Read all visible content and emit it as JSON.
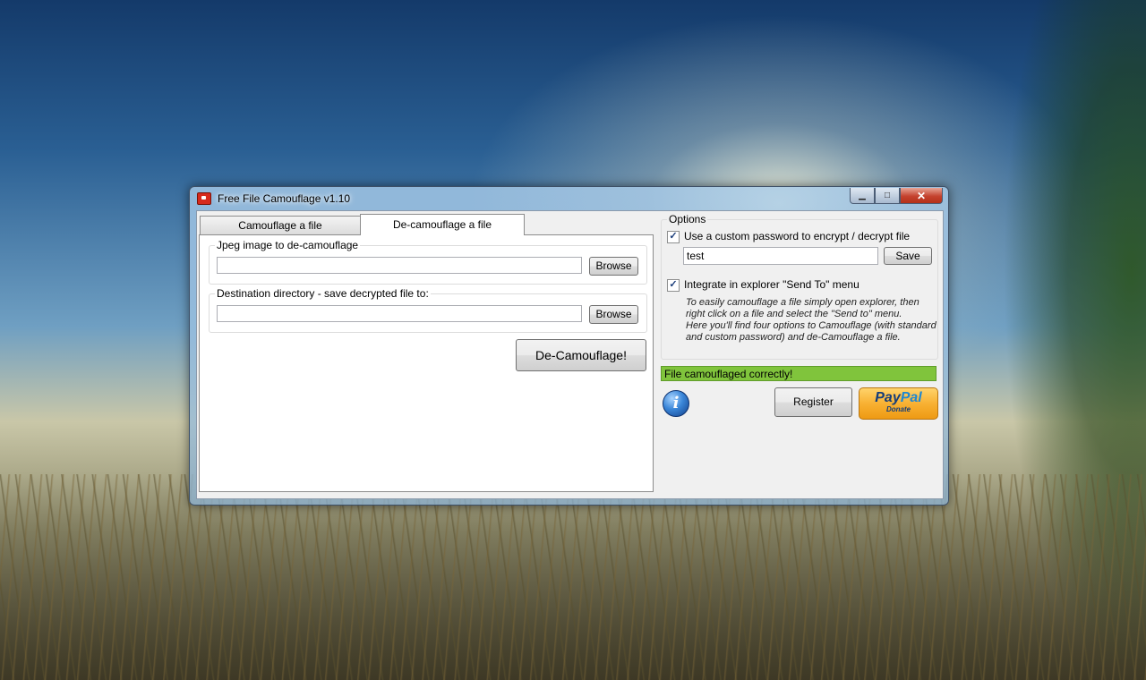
{
  "window": {
    "title": "Free File Camouflage v1.10",
    "controls": {
      "minimize": "▁",
      "maximize": "□",
      "close": "✕"
    }
  },
  "tabs": [
    {
      "label": "Camouflage a file",
      "active": false
    },
    {
      "label": "De-camouflage a file",
      "active": true
    }
  ],
  "decamouflage": {
    "jpeg_group_label": "Jpeg image to de-camouflage",
    "jpeg_value": "",
    "jpeg_browse_label": "Browse",
    "dest_group_label": "Destination directory - save decrypted file to:",
    "dest_value": "",
    "dest_browse_label": "Browse",
    "action_label": "De-Camouflage!"
  },
  "options": {
    "group_label": "Options",
    "custom_password_label": "Use a custom password to encrypt / decrypt file",
    "custom_password_checked": true,
    "password_value": "test",
    "save_label": "Save",
    "integrate_label": "Integrate in explorer \"Send To\" menu",
    "integrate_checked": true,
    "hint_lines": [
      "To easily camouflage a file simply open explorer, then",
      "right click on a file and select the \"Send to\" menu.",
      "Here you'll find four options to Camouflage (with standard",
      "and custom password) and de-Camouflage a file."
    ]
  },
  "status": {
    "text": "File camouflaged correctly!",
    "color": "#80c43c"
  },
  "footer": {
    "register_label": "Register",
    "paypal_logo_pay": "Pay",
    "paypal_logo_pal": "Pal",
    "paypal_donate": "Donate"
  },
  "icons": {
    "app": "app-icon",
    "info": "info-icon"
  }
}
